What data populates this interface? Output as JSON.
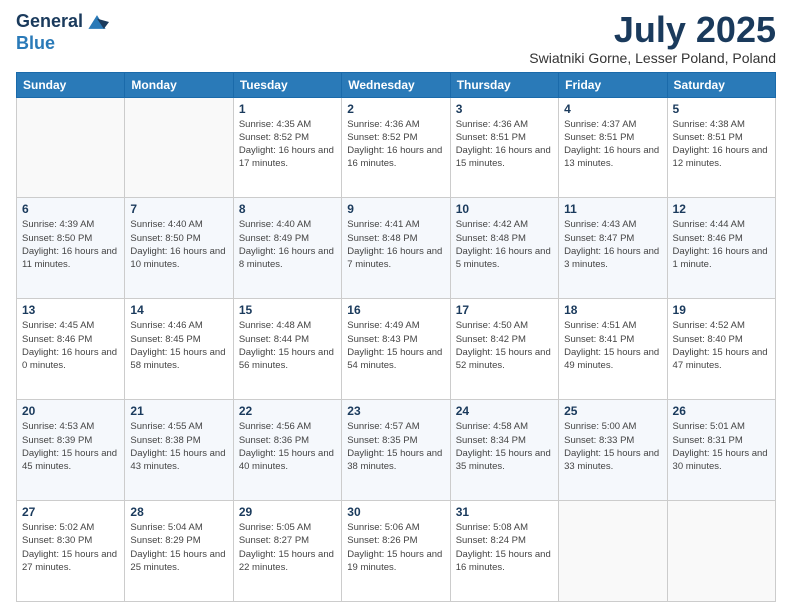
{
  "header": {
    "logo_line1": "General",
    "logo_line2": "Blue",
    "month_title": "July 2025",
    "location": "Swiatniki Gorne, Lesser Poland, Poland"
  },
  "weekdays": [
    "Sunday",
    "Monday",
    "Tuesday",
    "Wednesday",
    "Thursday",
    "Friday",
    "Saturday"
  ],
  "weeks": [
    [
      {
        "day": "",
        "sunrise": "",
        "sunset": "",
        "daylight": ""
      },
      {
        "day": "",
        "sunrise": "",
        "sunset": "",
        "daylight": ""
      },
      {
        "day": "1",
        "sunrise": "Sunrise: 4:35 AM",
        "sunset": "Sunset: 8:52 PM",
        "daylight": "Daylight: 16 hours and 17 minutes."
      },
      {
        "day": "2",
        "sunrise": "Sunrise: 4:36 AM",
        "sunset": "Sunset: 8:52 PM",
        "daylight": "Daylight: 16 hours and 16 minutes."
      },
      {
        "day": "3",
        "sunrise": "Sunrise: 4:36 AM",
        "sunset": "Sunset: 8:51 PM",
        "daylight": "Daylight: 16 hours and 15 minutes."
      },
      {
        "day": "4",
        "sunrise": "Sunrise: 4:37 AM",
        "sunset": "Sunset: 8:51 PM",
        "daylight": "Daylight: 16 hours and 13 minutes."
      },
      {
        "day": "5",
        "sunrise": "Sunrise: 4:38 AM",
        "sunset": "Sunset: 8:51 PM",
        "daylight": "Daylight: 16 hours and 12 minutes."
      }
    ],
    [
      {
        "day": "6",
        "sunrise": "Sunrise: 4:39 AM",
        "sunset": "Sunset: 8:50 PM",
        "daylight": "Daylight: 16 hours and 11 minutes."
      },
      {
        "day": "7",
        "sunrise": "Sunrise: 4:40 AM",
        "sunset": "Sunset: 8:50 PM",
        "daylight": "Daylight: 16 hours and 10 minutes."
      },
      {
        "day": "8",
        "sunrise": "Sunrise: 4:40 AM",
        "sunset": "Sunset: 8:49 PM",
        "daylight": "Daylight: 16 hours and 8 minutes."
      },
      {
        "day": "9",
        "sunrise": "Sunrise: 4:41 AM",
        "sunset": "Sunset: 8:48 PM",
        "daylight": "Daylight: 16 hours and 7 minutes."
      },
      {
        "day": "10",
        "sunrise": "Sunrise: 4:42 AM",
        "sunset": "Sunset: 8:48 PM",
        "daylight": "Daylight: 16 hours and 5 minutes."
      },
      {
        "day": "11",
        "sunrise": "Sunrise: 4:43 AM",
        "sunset": "Sunset: 8:47 PM",
        "daylight": "Daylight: 16 hours and 3 minutes."
      },
      {
        "day": "12",
        "sunrise": "Sunrise: 4:44 AM",
        "sunset": "Sunset: 8:46 PM",
        "daylight": "Daylight: 16 hours and 1 minute."
      }
    ],
    [
      {
        "day": "13",
        "sunrise": "Sunrise: 4:45 AM",
        "sunset": "Sunset: 8:46 PM",
        "daylight": "Daylight: 16 hours and 0 minutes."
      },
      {
        "day": "14",
        "sunrise": "Sunrise: 4:46 AM",
        "sunset": "Sunset: 8:45 PM",
        "daylight": "Daylight: 15 hours and 58 minutes."
      },
      {
        "day": "15",
        "sunrise": "Sunrise: 4:48 AM",
        "sunset": "Sunset: 8:44 PM",
        "daylight": "Daylight: 15 hours and 56 minutes."
      },
      {
        "day": "16",
        "sunrise": "Sunrise: 4:49 AM",
        "sunset": "Sunset: 8:43 PM",
        "daylight": "Daylight: 15 hours and 54 minutes."
      },
      {
        "day": "17",
        "sunrise": "Sunrise: 4:50 AM",
        "sunset": "Sunset: 8:42 PM",
        "daylight": "Daylight: 15 hours and 52 minutes."
      },
      {
        "day": "18",
        "sunrise": "Sunrise: 4:51 AM",
        "sunset": "Sunset: 8:41 PM",
        "daylight": "Daylight: 15 hours and 49 minutes."
      },
      {
        "day": "19",
        "sunrise": "Sunrise: 4:52 AM",
        "sunset": "Sunset: 8:40 PM",
        "daylight": "Daylight: 15 hours and 47 minutes."
      }
    ],
    [
      {
        "day": "20",
        "sunrise": "Sunrise: 4:53 AM",
        "sunset": "Sunset: 8:39 PM",
        "daylight": "Daylight: 15 hours and 45 minutes."
      },
      {
        "day": "21",
        "sunrise": "Sunrise: 4:55 AM",
        "sunset": "Sunset: 8:38 PM",
        "daylight": "Daylight: 15 hours and 43 minutes."
      },
      {
        "day": "22",
        "sunrise": "Sunrise: 4:56 AM",
        "sunset": "Sunset: 8:36 PM",
        "daylight": "Daylight: 15 hours and 40 minutes."
      },
      {
        "day": "23",
        "sunrise": "Sunrise: 4:57 AM",
        "sunset": "Sunset: 8:35 PM",
        "daylight": "Daylight: 15 hours and 38 minutes."
      },
      {
        "day": "24",
        "sunrise": "Sunrise: 4:58 AM",
        "sunset": "Sunset: 8:34 PM",
        "daylight": "Daylight: 15 hours and 35 minutes."
      },
      {
        "day": "25",
        "sunrise": "Sunrise: 5:00 AM",
        "sunset": "Sunset: 8:33 PM",
        "daylight": "Daylight: 15 hours and 33 minutes."
      },
      {
        "day": "26",
        "sunrise": "Sunrise: 5:01 AM",
        "sunset": "Sunset: 8:31 PM",
        "daylight": "Daylight: 15 hours and 30 minutes."
      }
    ],
    [
      {
        "day": "27",
        "sunrise": "Sunrise: 5:02 AM",
        "sunset": "Sunset: 8:30 PM",
        "daylight": "Daylight: 15 hours and 27 minutes."
      },
      {
        "day": "28",
        "sunrise": "Sunrise: 5:04 AM",
        "sunset": "Sunset: 8:29 PM",
        "daylight": "Daylight: 15 hours and 25 minutes."
      },
      {
        "day": "29",
        "sunrise": "Sunrise: 5:05 AM",
        "sunset": "Sunset: 8:27 PM",
        "daylight": "Daylight: 15 hours and 22 minutes."
      },
      {
        "day": "30",
        "sunrise": "Sunrise: 5:06 AM",
        "sunset": "Sunset: 8:26 PM",
        "daylight": "Daylight: 15 hours and 19 minutes."
      },
      {
        "day": "31",
        "sunrise": "Sunrise: 5:08 AM",
        "sunset": "Sunset: 8:24 PM",
        "daylight": "Daylight: 15 hours and 16 minutes."
      },
      {
        "day": "",
        "sunrise": "",
        "sunset": "",
        "daylight": ""
      },
      {
        "day": "",
        "sunrise": "",
        "sunset": "",
        "daylight": ""
      }
    ]
  ]
}
